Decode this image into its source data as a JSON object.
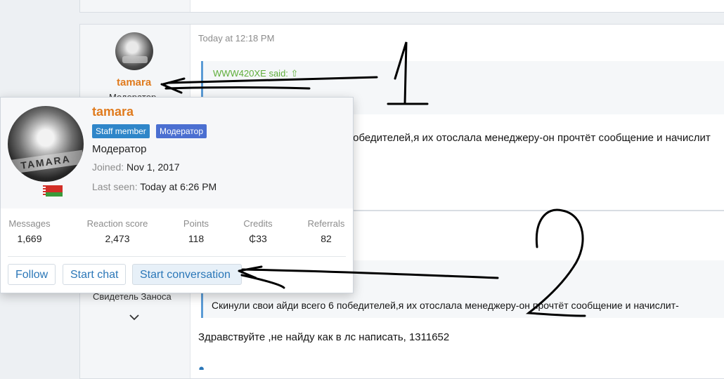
{
  "post1": {
    "time": "Today at 12:18 PM",
    "username": "tamara",
    "role_partial": "Модератор",
    "quote_author": "WWW420XE said:",
    "body_partial": "победителей,я их отослала менеджеру-он прочтёт сообщение и начислит"
  },
  "post2": {
    "user_title": "Свидетель Заноса",
    "quote_text": "Скинули свои айди всего 6 победителей,я их отослала менеджеру-он прочтёт сообщение и начислит-",
    "body_text": "Здравствуйте ,не найду как в лс написать, 1311652"
  },
  "popup": {
    "username": "tamara",
    "badge_staff": "Staff member",
    "badge_role": "Модератор",
    "role": "Модератор",
    "joined_label": "Joined:",
    "joined_value": "Nov 1, 2017",
    "last_seen_label": "Last seen:",
    "last_seen_value": "Today at 6:26 PM",
    "avatar_text": "TAMARA",
    "stats": [
      {
        "label": "Messages",
        "value": "1,669"
      },
      {
        "label": "Reaction score",
        "value": "2,473"
      },
      {
        "label": "Points",
        "value": "118"
      },
      {
        "label": "Credits",
        "value": "₵33"
      },
      {
        "label": "Referrals",
        "value": "82"
      }
    ],
    "buttons": {
      "follow": "Follow",
      "start_chat": "Start chat",
      "start_conversation": "Start conversation"
    }
  },
  "annotations": {
    "arrow1_number": "1",
    "arrow2_number": "2"
  },
  "colors": {
    "username": "#e07b1e",
    "link": "#2b77b8",
    "badge_staff": "#2f86c9",
    "badge_role": "#4b6fd1",
    "quote_author": "#5fae3a"
  }
}
